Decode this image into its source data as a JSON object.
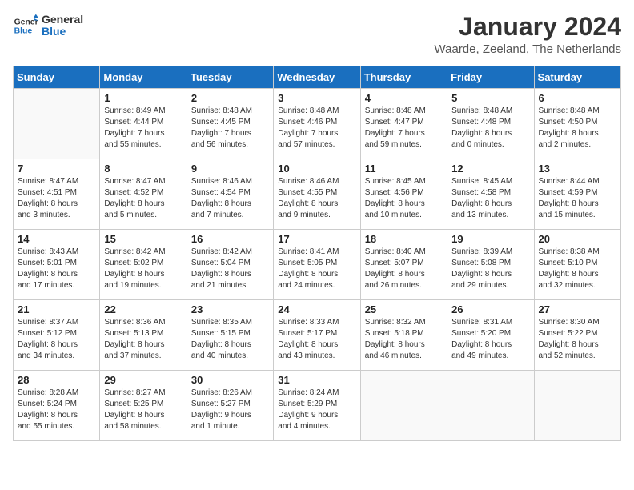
{
  "logo": {
    "line1": "General",
    "line2": "Blue"
  },
  "title": "January 2024",
  "subtitle": "Waarde, Zeeland, The Netherlands",
  "days_header": [
    "Sunday",
    "Monday",
    "Tuesday",
    "Wednesday",
    "Thursday",
    "Friday",
    "Saturday"
  ],
  "weeks": [
    [
      {
        "day": "",
        "info": ""
      },
      {
        "day": "1",
        "info": "Sunrise: 8:49 AM\nSunset: 4:44 PM\nDaylight: 7 hours\nand 55 minutes."
      },
      {
        "day": "2",
        "info": "Sunrise: 8:48 AM\nSunset: 4:45 PM\nDaylight: 7 hours\nand 56 minutes."
      },
      {
        "day": "3",
        "info": "Sunrise: 8:48 AM\nSunset: 4:46 PM\nDaylight: 7 hours\nand 57 minutes."
      },
      {
        "day": "4",
        "info": "Sunrise: 8:48 AM\nSunset: 4:47 PM\nDaylight: 7 hours\nand 59 minutes."
      },
      {
        "day": "5",
        "info": "Sunrise: 8:48 AM\nSunset: 4:48 PM\nDaylight: 8 hours\nand 0 minutes."
      },
      {
        "day": "6",
        "info": "Sunrise: 8:48 AM\nSunset: 4:50 PM\nDaylight: 8 hours\nand 2 minutes."
      }
    ],
    [
      {
        "day": "7",
        "info": "Sunrise: 8:47 AM\nSunset: 4:51 PM\nDaylight: 8 hours\nand 3 minutes."
      },
      {
        "day": "8",
        "info": "Sunrise: 8:47 AM\nSunset: 4:52 PM\nDaylight: 8 hours\nand 5 minutes."
      },
      {
        "day": "9",
        "info": "Sunrise: 8:46 AM\nSunset: 4:54 PM\nDaylight: 8 hours\nand 7 minutes."
      },
      {
        "day": "10",
        "info": "Sunrise: 8:46 AM\nSunset: 4:55 PM\nDaylight: 8 hours\nand 9 minutes."
      },
      {
        "day": "11",
        "info": "Sunrise: 8:45 AM\nSunset: 4:56 PM\nDaylight: 8 hours\nand 10 minutes."
      },
      {
        "day": "12",
        "info": "Sunrise: 8:45 AM\nSunset: 4:58 PM\nDaylight: 8 hours\nand 13 minutes."
      },
      {
        "day": "13",
        "info": "Sunrise: 8:44 AM\nSunset: 4:59 PM\nDaylight: 8 hours\nand 15 minutes."
      }
    ],
    [
      {
        "day": "14",
        "info": "Sunrise: 8:43 AM\nSunset: 5:01 PM\nDaylight: 8 hours\nand 17 minutes."
      },
      {
        "day": "15",
        "info": "Sunrise: 8:42 AM\nSunset: 5:02 PM\nDaylight: 8 hours\nand 19 minutes."
      },
      {
        "day": "16",
        "info": "Sunrise: 8:42 AM\nSunset: 5:04 PM\nDaylight: 8 hours\nand 21 minutes."
      },
      {
        "day": "17",
        "info": "Sunrise: 8:41 AM\nSunset: 5:05 PM\nDaylight: 8 hours\nand 24 minutes."
      },
      {
        "day": "18",
        "info": "Sunrise: 8:40 AM\nSunset: 5:07 PM\nDaylight: 8 hours\nand 26 minutes."
      },
      {
        "day": "19",
        "info": "Sunrise: 8:39 AM\nSunset: 5:08 PM\nDaylight: 8 hours\nand 29 minutes."
      },
      {
        "day": "20",
        "info": "Sunrise: 8:38 AM\nSunset: 5:10 PM\nDaylight: 8 hours\nand 32 minutes."
      }
    ],
    [
      {
        "day": "21",
        "info": "Sunrise: 8:37 AM\nSunset: 5:12 PM\nDaylight: 8 hours\nand 34 minutes."
      },
      {
        "day": "22",
        "info": "Sunrise: 8:36 AM\nSunset: 5:13 PM\nDaylight: 8 hours\nand 37 minutes."
      },
      {
        "day": "23",
        "info": "Sunrise: 8:35 AM\nSunset: 5:15 PM\nDaylight: 8 hours\nand 40 minutes."
      },
      {
        "day": "24",
        "info": "Sunrise: 8:33 AM\nSunset: 5:17 PM\nDaylight: 8 hours\nand 43 minutes."
      },
      {
        "day": "25",
        "info": "Sunrise: 8:32 AM\nSunset: 5:18 PM\nDaylight: 8 hours\nand 46 minutes."
      },
      {
        "day": "26",
        "info": "Sunrise: 8:31 AM\nSunset: 5:20 PM\nDaylight: 8 hours\nand 49 minutes."
      },
      {
        "day": "27",
        "info": "Sunrise: 8:30 AM\nSunset: 5:22 PM\nDaylight: 8 hours\nand 52 minutes."
      }
    ],
    [
      {
        "day": "28",
        "info": "Sunrise: 8:28 AM\nSunset: 5:24 PM\nDaylight: 8 hours\nand 55 minutes."
      },
      {
        "day": "29",
        "info": "Sunrise: 8:27 AM\nSunset: 5:25 PM\nDaylight: 8 hours\nand 58 minutes."
      },
      {
        "day": "30",
        "info": "Sunrise: 8:26 AM\nSunset: 5:27 PM\nDaylight: 9 hours\nand 1 minute."
      },
      {
        "day": "31",
        "info": "Sunrise: 8:24 AM\nSunset: 5:29 PM\nDaylight: 9 hours\nand 4 minutes."
      },
      {
        "day": "",
        "info": ""
      },
      {
        "day": "",
        "info": ""
      },
      {
        "day": "",
        "info": ""
      }
    ]
  ]
}
